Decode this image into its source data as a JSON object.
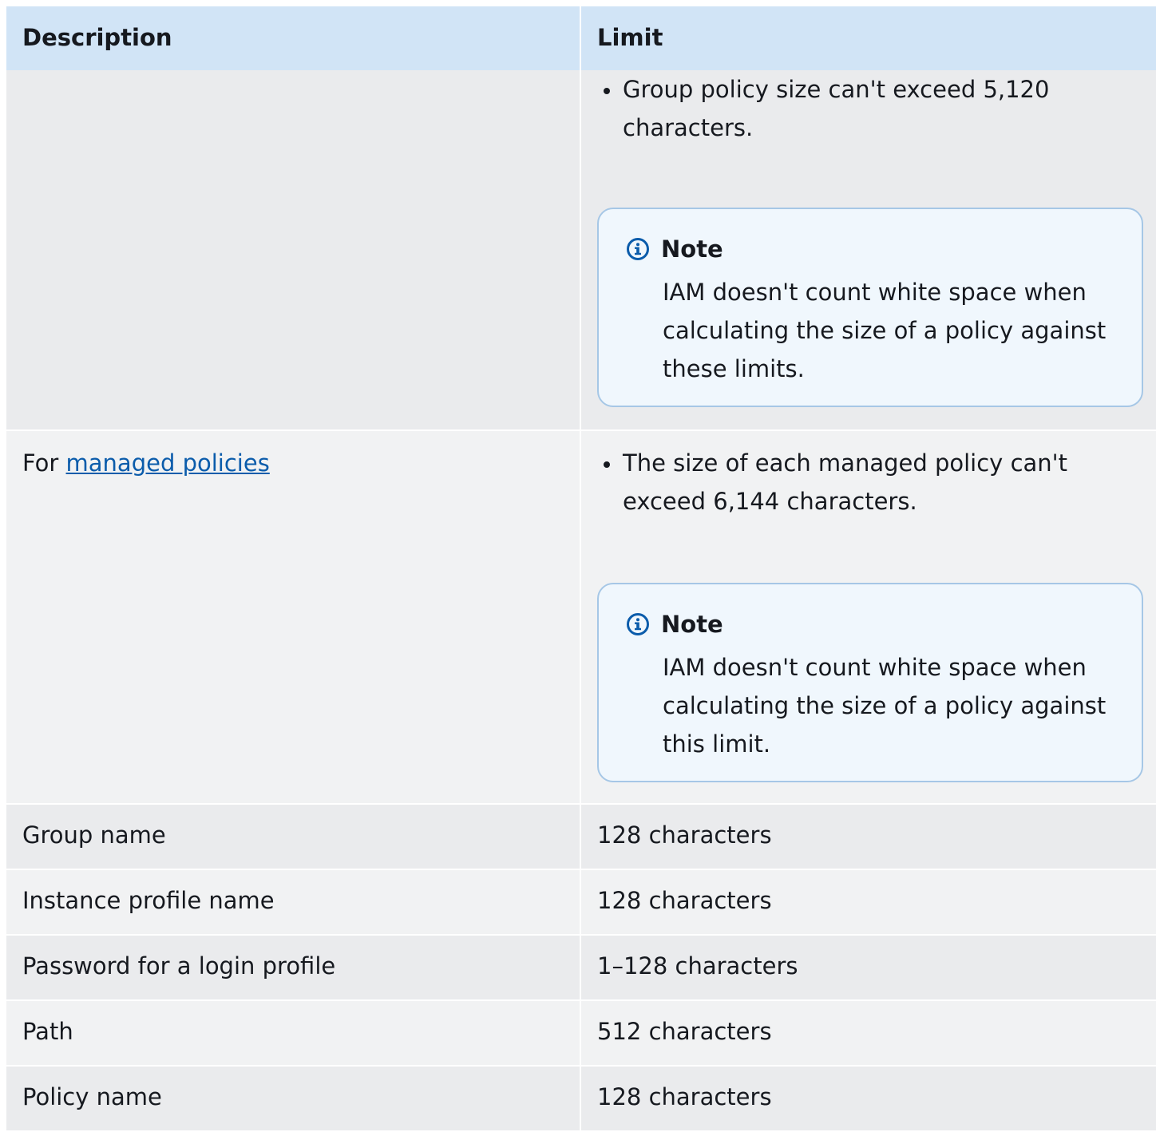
{
  "table": {
    "headers": {
      "description": "Description",
      "limit": "Limit"
    },
    "group_policy_row": {
      "bullet": "Group policy size can't exceed 5,120 characters.",
      "note_title": "Note",
      "note_text": "IAM doesn't count white space when calculating the size of a policy against these limits."
    },
    "managed_row": {
      "prefix": "For ",
      "link_text": "managed policies",
      "bullet": "The size of each managed policy can't exceed 6,144 characters.",
      "note_title": "Note",
      "note_text": "IAM doesn't count white space when calculating the size of a policy against this limit."
    },
    "rows": [
      {
        "description": "Group name",
        "limit": "128 characters"
      },
      {
        "description": "Instance profile name",
        "limit": "128 characters"
      },
      {
        "description": "Password for a login profile",
        "limit": "1–128 characters"
      },
      {
        "description": "Path",
        "limit": "512 characters"
      },
      {
        "description": "Policy name",
        "limit": "128 characters"
      }
    ]
  },
  "icons": {
    "note_icon": "info-circle-icon"
  },
  "colors": {
    "header_bg": "#d1e4f6",
    "note_border": "#a6c7e6",
    "note_bg": "#f0f7fd",
    "link": "#0b5cab",
    "info_icon": "#0b5cab"
  }
}
